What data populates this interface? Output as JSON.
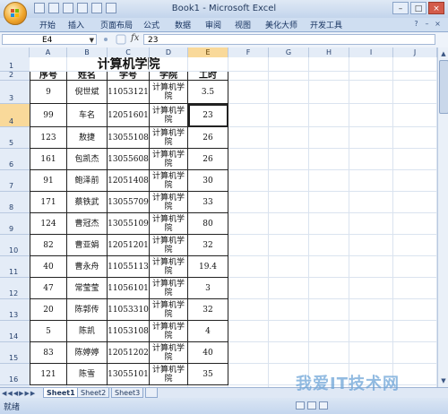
{
  "window": {
    "title": "Book1 - Microsoft Excel",
    "controls": [
      "–",
      "□",
      "×"
    ]
  },
  "ribbon": {
    "tabs": [
      "开始",
      "插入",
      "页面布局",
      "公式",
      "数据",
      "审阅",
      "视图",
      "美化大师",
      "开发工具"
    ]
  },
  "formula_bar": {
    "cell_ref": "E4",
    "fx": "fx",
    "value": "23"
  },
  "columns": [
    "A",
    "B",
    "C",
    "D",
    "E",
    "F",
    "G",
    "H",
    "I",
    "J"
  ],
  "active_column": "E",
  "active_row": "4",
  "row_numbers": [
    "1",
    "2",
    "3",
    "4",
    "5",
    "6",
    "7",
    "8",
    "9",
    "10",
    "11",
    "12",
    "13",
    "14",
    "15",
    "16"
  ],
  "table": {
    "title": "计算机学院",
    "headers": [
      "序号",
      "姓名",
      "学号",
      "学院",
      "工时"
    ],
    "rows": [
      [
        "9",
        "倪世斌",
        "11053121",
        "计算机学院",
        "3.5"
      ],
      [
        "99",
        "车名",
        "12051601",
        "计算机学院",
        "23"
      ],
      [
        "123",
        "敖捷",
        "13055108",
        "计算机学院",
        "26"
      ],
      [
        "161",
        "包凯杰",
        "13055608",
        "计算机学院",
        "26"
      ],
      [
        "91",
        "鲍泽前",
        "12051408",
        "计算机学院",
        "30"
      ],
      [
        "171",
        "蔡铁武",
        "13055709",
        "计算机学院",
        "33"
      ],
      [
        "124",
        "曹冠杰",
        "13055109",
        "计算机学院",
        "80"
      ],
      [
        "82",
        "曹亚娟",
        "12051201",
        "计算机学院",
        "32"
      ],
      [
        "40",
        "曹永舟",
        "11055113",
        "计算机学院",
        "19.4"
      ],
      [
        "47",
        "常莹莹",
        "11056101",
        "计算机学院",
        "3"
      ],
      [
        "20",
        "陈郭传",
        "11053310",
        "计算机学院",
        "32"
      ],
      [
        "5",
        "陈凯",
        "11053108",
        "计算机学院",
        "4"
      ],
      [
        "83",
        "陈婷婷",
        "12051202",
        "计算机学院",
        "40"
      ],
      [
        "121",
        "陈雪",
        "13055101",
        "计算机学院",
        "35"
      ]
    ]
  },
  "sheets": [
    "Sheet1",
    "Sheet2",
    "Sheet3"
  ],
  "active_sheet": "Sheet1",
  "status": "就绪",
  "watermark": "我爱IT技术网"
}
